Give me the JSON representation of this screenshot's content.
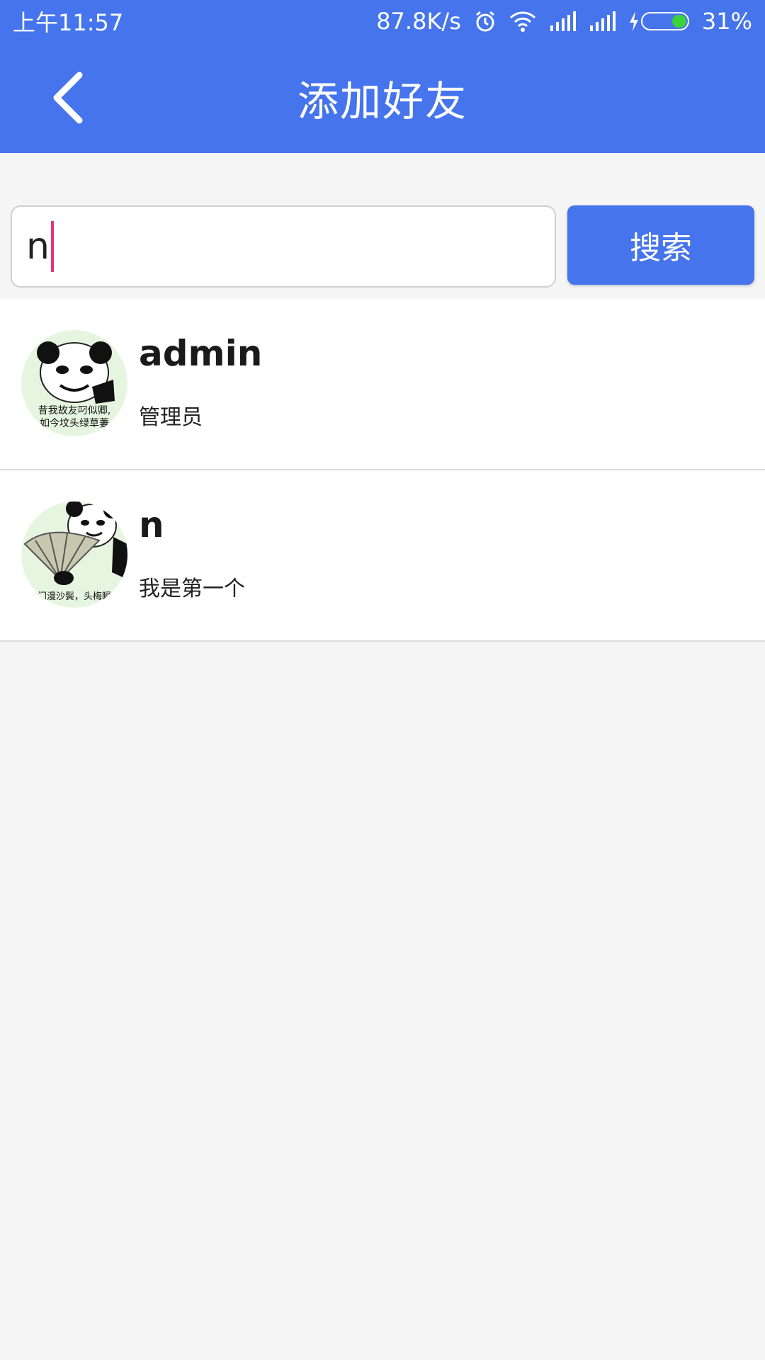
{
  "status_bar": {
    "time": "上午11:57",
    "net_speed": "87.8K/s",
    "battery": "31%",
    "icons": [
      "alarm-icon",
      "wifi-icon",
      "signal-icon",
      "signal-icon",
      "charging-icon",
      "battery-icon"
    ]
  },
  "header": {
    "title": "添加好友",
    "back_icon": "chevron-left-icon",
    "background": "#4574ec"
  },
  "search": {
    "value": "n",
    "button_label": "搜索"
  },
  "results": [
    {
      "name": "admin",
      "signature": "管理员",
      "avatar": "panda-meme-avatar"
    },
    {
      "name": "n",
      "signature": "我是第一个",
      "avatar": "panda-meme-avatar"
    }
  ],
  "colors": {
    "primary": "#4574ec",
    "caret": "#e5337a",
    "battery_fill": "#3ad13a"
  }
}
